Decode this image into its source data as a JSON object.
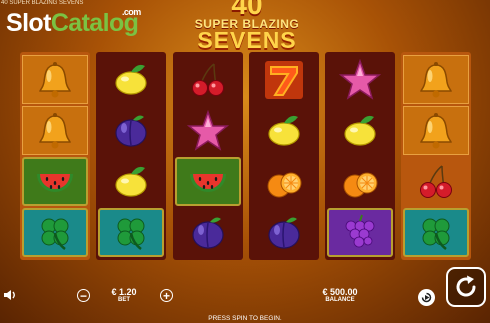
{
  "app": {
    "window_title": "40 SUPER BLAZING SEVENS"
  },
  "brand": {
    "slot": "Slot",
    "catalog": "Catalog",
    "com": ".com"
  },
  "game_logo": {
    "number": "40",
    "line1": "SUPER BLAZING",
    "line2": "SEVENS"
  },
  "reels": [
    {
      "bg": "#b8570e",
      "symbols": [
        "bell",
        "bell",
        "watermelon",
        "clover"
      ]
    },
    {
      "bg": "#5a1208",
      "symbols": [
        "lemon",
        "plum",
        "lemon",
        "clover"
      ]
    },
    {
      "bg": "#5a1208",
      "symbols": [
        "cherry",
        "star",
        "watermelon",
        "plum"
      ]
    },
    {
      "bg": "#5a1208",
      "symbols": [
        "seven",
        "lemon",
        "orange",
        "plum"
      ]
    },
    {
      "bg": "#5a1208",
      "symbols": [
        "star",
        "lemon",
        "orange",
        "grapes"
      ]
    },
    {
      "bg": "#b8570e",
      "symbols": [
        "bell",
        "bell",
        "cherry",
        "clover"
      ]
    }
  ],
  "highlighted": {
    "bell": true,
    "watermelon": true,
    "clover": true,
    "grapes": true,
    "seven": true
  },
  "bet": {
    "value": "€ 1.20",
    "label": "BET"
  },
  "balance": {
    "value": "€ 500.00",
    "label": "BALANCE"
  },
  "hint": "PRESS SPIN TO BEGIN.",
  "icons": {
    "sound": "speaker-icon",
    "minus": "minus-icon",
    "plus": "plus-icon",
    "autoplay": "autoplay-icon",
    "spin": "spin-icon"
  }
}
